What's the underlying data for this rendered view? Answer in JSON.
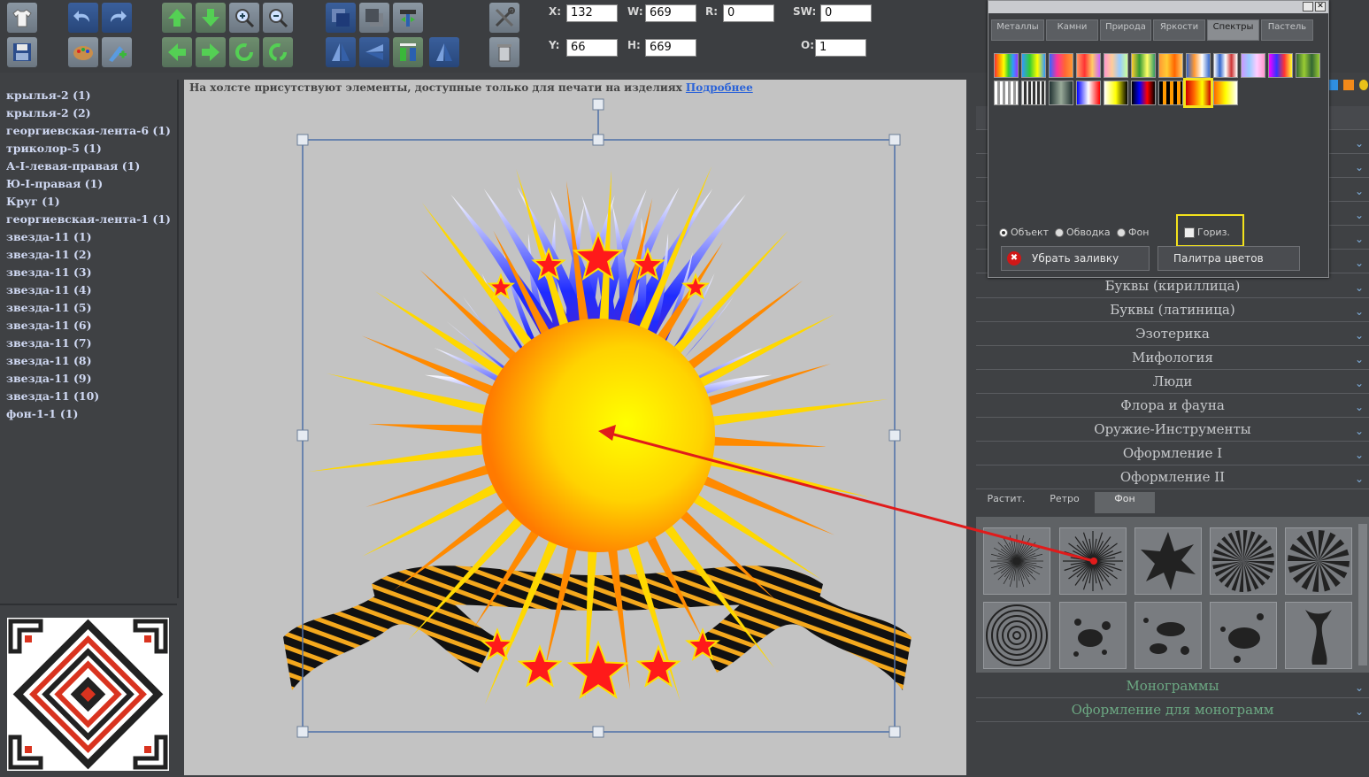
{
  "toolbar": {
    "fields": {
      "x": {
        "label": "X:",
        "value": "132"
      },
      "y": {
        "label": "Y:",
        "value": "66"
      },
      "w": {
        "label": "W:",
        "value": "669"
      },
      "h": {
        "label": "H:",
        "value": "669"
      },
      "r": {
        "label": "R:",
        "value": "0"
      },
      "sw": {
        "label": "SW:",
        "value": "0"
      },
      "o": {
        "label": "O:",
        "value": "1"
      }
    }
  },
  "layers": [
    "крылья-2 (1)",
    "крылья-2 (2)",
    "георгиевская-лента-6 (1)",
    "триколор-5 (1)",
    "А-I-левая-правая (1)",
    "Ю-I-правая (1)",
    "Круг (1)",
    "георгиевская-лента-1 (1)",
    "звезда-11 (1)",
    "звезда-11 (2)",
    "звезда-11 (3)",
    "звезда-11 (4)",
    "звезда-11 (5)",
    "звезда-11 (6)",
    "звезда-11 (7)",
    "звезда-11 (8)",
    "звезда-11 (9)",
    "звезда-11 (10)",
    "фон-1-1 (1)"
  ],
  "canvas": {
    "notice": "На холсте присутствуют элементы, доступные только для печати на изделиях",
    "notice_link": "Подробнее"
  },
  "popup": {
    "tabs": [
      "Металлы",
      "Камни",
      "Природа",
      "Яркости",
      "Спектры",
      "Пастель"
    ],
    "active_tab": "Спектры",
    "radios": [
      "Объект",
      "Обводка",
      "Фон"
    ],
    "checkbox": "Гориз.",
    "remove_fill": "Убрать заливку",
    "palette": "Палитра цветов"
  },
  "categories": [
    "Буквы (кириллица)",
    "Буквы (латиница)",
    "Эзотерика",
    "Мифология",
    "Люди",
    "Флора и фауна",
    "Оружие-Инструменты",
    "Оформление I",
    "Оформление II"
  ],
  "subtabs": [
    "Растит.",
    "Ретро",
    "Фон"
  ],
  "active_subtab": "Фон",
  "bottom_categories": [
    "Монограммы",
    "Оформление для монограмм"
  ],
  "colors": {
    "highlight": "#f3e21c",
    "arrow": "#e01b1b",
    "link": "#2b63d8"
  }
}
